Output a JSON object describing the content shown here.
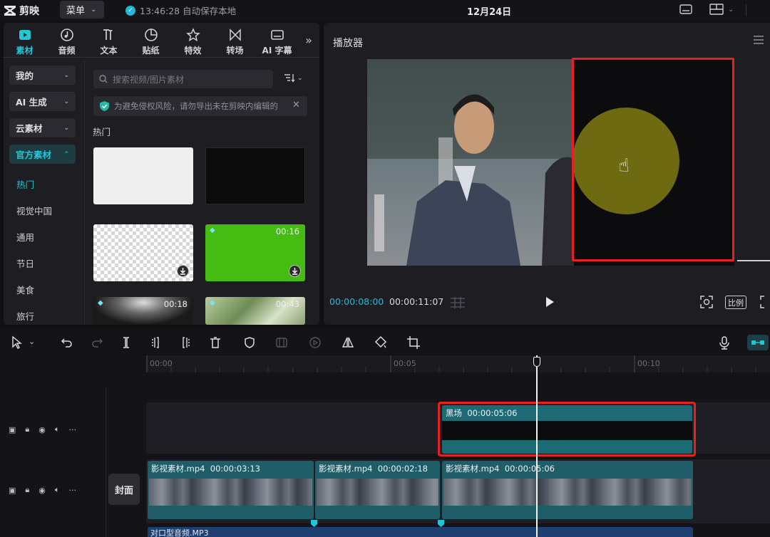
{
  "app": {
    "name": "剪映",
    "menu_label": "菜单",
    "save_status": "13:46:28 自动保存本地",
    "date": "12月24日"
  },
  "library": {
    "tabs": [
      {
        "label": "素材",
        "icon": "media-icon",
        "active": true
      },
      {
        "label": "音频",
        "icon": "audio-icon"
      },
      {
        "label": "文本",
        "icon": "text-icon"
      },
      {
        "label": "贴纸",
        "icon": "sticker-icon"
      },
      {
        "label": "特效",
        "icon": "effects-icon"
      },
      {
        "label": "转场",
        "icon": "transition-icon"
      },
      {
        "label": "AI 字幕",
        "icon": "subtitle-icon"
      }
    ],
    "categories": [
      {
        "label": "我的"
      },
      {
        "label": "AI 生成"
      },
      {
        "label": "云素材"
      },
      {
        "label": "官方素材"
      }
    ],
    "subcategories": [
      "热门",
      "视觉中国",
      "通用",
      "节日",
      "美食",
      "旅行"
    ],
    "search_placeholder": "搜索视频/图片素材",
    "notice": "为避免侵权风险，请勿导出未在剪映内编辑的",
    "section_title": "热门",
    "thumbnails": [
      {
        "kind": "white"
      },
      {
        "kind": "black"
      },
      {
        "kind": "transparent"
      },
      {
        "kind": "green",
        "duration": "00:16"
      },
      {
        "kind": "spotlight",
        "duration": "00:18"
      },
      {
        "kind": "foliage",
        "duration": "00:43"
      }
    ]
  },
  "player": {
    "title": "播放器",
    "current_time": "00:00:08:00",
    "total_time": "00:00:11:07",
    "ratio_label": "比例"
  },
  "timeline": {
    "ruler": [
      "00:00",
      "00:05",
      "00:10"
    ],
    "cover_label": "封面",
    "overlay_clip": {
      "name": "黑场",
      "duration": "00:00:05:06"
    },
    "main_clips": [
      {
        "name": "影视素材.mp4",
        "duration": "00:00:03:13"
      },
      {
        "name": "影视素材.mp4",
        "duration": "00:00:02:18"
      },
      {
        "name": "影视素材.mp4",
        "duration": "00:00:05:06"
      }
    ],
    "audio_clip": {
      "name": "对口型音频.MP3"
    }
  },
  "colors": {
    "accent": "#22c7d6",
    "highlight": "#e52222",
    "clip": "#1f5d68"
  }
}
